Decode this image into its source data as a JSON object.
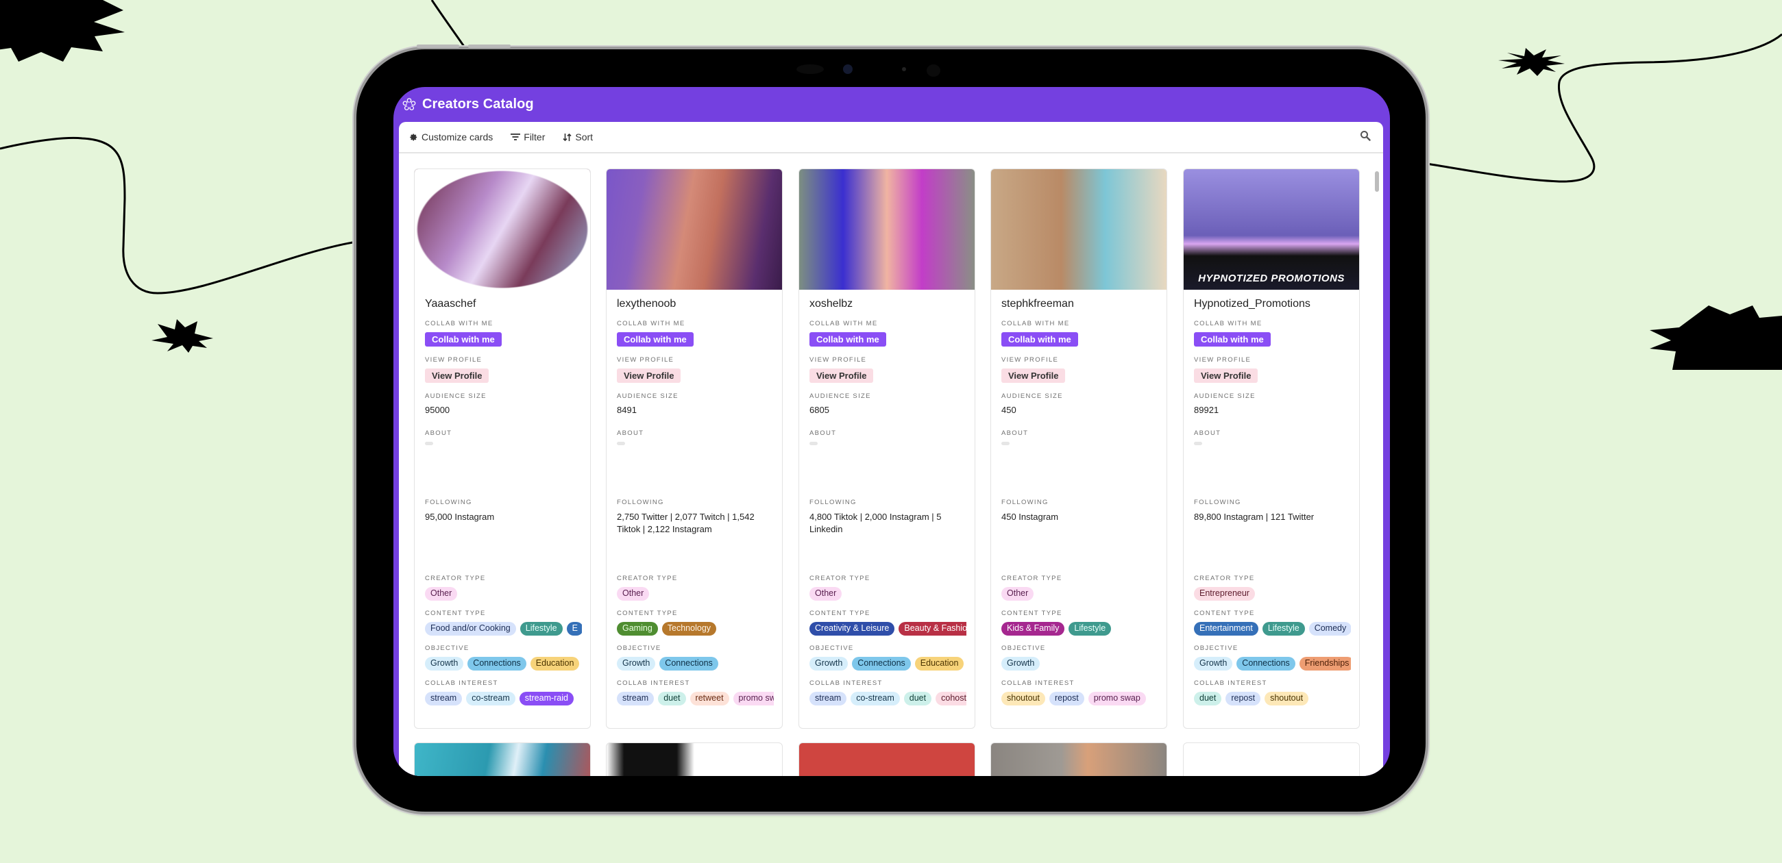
{
  "app": {
    "title": "Creators Catalog",
    "logo_icon": "asterisk-flower-icon",
    "accent_color": "#7440e0"
  },
  "toolbar": {
    "customize_label": "Customize cards",
    "filter_label": "Filter",
    "sort_label": "Sort",
    "search_icon": "search-icon"
  },
  "field_labels": {
    "collab": "Collab with me",
    "view_profile": "View profile",
    "audience": "Audience size",
    "about": "About",
    "following": "Following",
    "creator_type": "Creator type",
    "content_type": "Content type",
    "objective": "Objective",
    "collab_interest": "Collab interest"
  },
  "buttons": {
    "collab": "Collab with me",
    "view_profile": "View Profile"
  },
  "cards": [
    {
      "name": "Yaaaschef",
      "audience_size": "95000",
      "following": "95,000 Instagram",
      "creator_type": [
        {
          "label": "Other",
          "bg": "#fadaf3",
          "fg": "#5a2050"
        }
      ],
      "content_type": [
        {
          "label": "Food and/or Cooking",
          "bg": "#d6e2fb",
          "fg": "#1d2d55"
        },
        {
          "label": "Lifestyle",
          "bg": "#3f9a8e",
          "fg": "#e9fffb"
        },
        {
          "label": "E",
          "bg": "#3570b8",
          "fg": "#ffffff"
        }
      ],
      "objective": [
        {
          "label": "Growth",
          "bg": "#d6eefb",
          "fg": "#14344a"
        },
        {
          "label": "Connections",
          "bg": "#7ec7eb",
          "fg": "#0e2f45"
        },
        {
          "label": "Education",
          "bg": "#f7d37a",
          "fg": "#4a3300"
        }
      ],
      "collab_interest": [
        {
          "label": "stream",
          "bg": "#d6e2fb",
          "fg": "#1d2d55"
        },
        {
          "label": "co-stream",
          "bg": "#d6eefb",
          "fg": "#14344a"
        },
        {
          "label": "stream-raid",
          "bg": "#8a4ef5",
          "fg": "#ffffff"
        }
      ]
    },
    {
      "name": "lexythenoob",
      "audience_size": "8491",
      "following": "2,750 Twitter | 2,077 Twitch | 1,542 Tiktok | 2,122 Instagram",
      "creator_type": [
        {
          "label": "Other",
          "bg": "#fadaf3",
          "fg": "#5a2050"
        }
      ],
      "content_type": [
        {
          "label": "Gaming",
          "bg": "#4f8d31",
          "fg": "#e9ffe0"
        },
        {
          "label": "Technology",
          "bg": "#b6782c",
          "fg": "#fff4e6"
        }
      ],
      "objective": [
        {
          "label": "Growth",
          "bg": "#d6eefb",
          "fg": "#14344a"
        },
        {
          "label": "Connections",
          "bg": "#7ec7eb",
          "fg": "#0e2f45"
        }
      ],
      "collab_interest": [
        {
          "label": "stream",
          "bg": "#d6e2fb",
          "fg": "#1d2d55"
        },
        {
          "label": "duet",
          "bg": "#cdf0ea",
          "fg": "#103f38"
        },
        {
          "label": "retweet",
          "bg": "#fde2d8",
          "fg": "#6a2b12"
        },
        {
          "label": "promo swap",
          "bg": "#fadaf3",
          "fg": "#5a2050"
        }
      ]
    },
    {
      "name": "xoshelbz",
      "audience_size": "6805",
      "following": "4,800 Tiktok | 2,000 Instagram | 5 Linkedin",
      "creator_type": [
        {
          "label": "Other",
          "bg": "#fadaf3",
          "fg": "#5a2050"
        }
      ],
      "content_type": [
        {
          "label": "Creativity & Leisure",
          "bg": "#2f4ea9",
          "fg": "#ffffff"
        },
        {
          "label": "Beauty & Fashion",
          "bg": "#b83045",
          "fg": "#ffffff"
        }
      ],
      "objective": [
        {
          "label": "Growth",
          "bg": "#d6eefb",
          "fg": "#14344a"
        },
        {
          "label": "Connections",
          "bg": "#7ec7eb",
          "fg": "#0e2f45"
        },
        {
          "label": "Education",
          "bg": "#f7d37a",
          "fg": "#4a3300"
        }
      ],
      "collab_interest": [
        {
          "label": "stream",
          "bg": "#d6e2fb",
          "fg": "#1d2d55"
        },
        {
          "label": "co-stream",
          "bg": "#d6eefb",
          "fg": "#14344a"
        },
        {
          "label": "duet",
          "bg": "#cdf0ea",
          "fg": "#103f38"
        },
        {
          "label": "cohost",
          "bg": "#fbdce4",
          "fg": "#5c1a2b"
        }
      ]
    },
    {
      "name": "stephkfreeman",
      "audience_size": "450",
      "following": "450 Instagram",
      "creator_type": [
        {
          "label": "Other",
          "bg": "#fadaf3",
          "fg": "#5a2050"
        }
      ],
      "content_type": [
        {
          "label": "Kids & Family",
          "bg": "#a5278f",
          "fg": "#ffffff"
        },
        {
          "label": "Lifestyle",
          "bg": "#3f9a8e",
          "fg": "#e9fffb"
        }
      ],
      "objective": [
        {
          "label": "Growth",
          "bg": "#d6eefb",
          "fg": "#14344a"
        }
      ],
      "collab_interest": [
        {
          "label": "shoutout",
          "bg": "#fde8b8",
          "fg": "#4a3300"
        },
        {
          "label": "repost",
          "bg": "#d6e2fb",
          "fg": "#1d2d55"
        },
        {
          "label": "promo swap",
          "bg": "#fadaf3",
          "fg": "#5a2050"
        }
      ]
    },
    {
      "name": "Hypnotized_Promotions",
      "audience_size": "89921",
      "following": "89,800 Instagram | 121 Twitter",
      "creator_type": [
        {
          "label": "Entrepreneur",
          "bg": "#fbdce4",
          "fg": "#5c1a2b"
        }
      ],
      "content_type": [
        {
          "label": "Entertainment",
          "bg": "#3570b8",
          "fg": "#ffffff"
        },
        {
          "label": "Lifestyle",
          "bg": "#3f9a8e",
          "fg": "#e9fffb"
        },
        {
          "label": "Comedy",
          "bg": "#d6e2fb",
          "fg": "#1d2d55"
        }
      ],
      "objective": [
        {
          "label": "Growth",
          "bg": "#d6eefb",
          "fg": "#14344a"
        },
        {
          "label": "Connections",
          "bg": "#7ec7eb",
          "fg": "#0e2f45"
        },
        {
          "label": "Friendships",
          "bg": "#ee9d72",
          "fg": "#4a1e07"
        }
      ],
      "collab_interest": [
        {
          "label": "duet",
          "bg": "#cdf0ea",
          "fg": "#103f38"
        },
        {
          "label": "repost",
          "bg": "#d6e2fb",
          "fg": "#1d2d55"
        },
        {
          "label": "shoutout",
          "bg": "#fde8b8",
          "fg": "#4a3300"
        }
      ]
    }
  ],
  "image_banner_text": "HYPNOTIZED PROMOTIONS"
}
